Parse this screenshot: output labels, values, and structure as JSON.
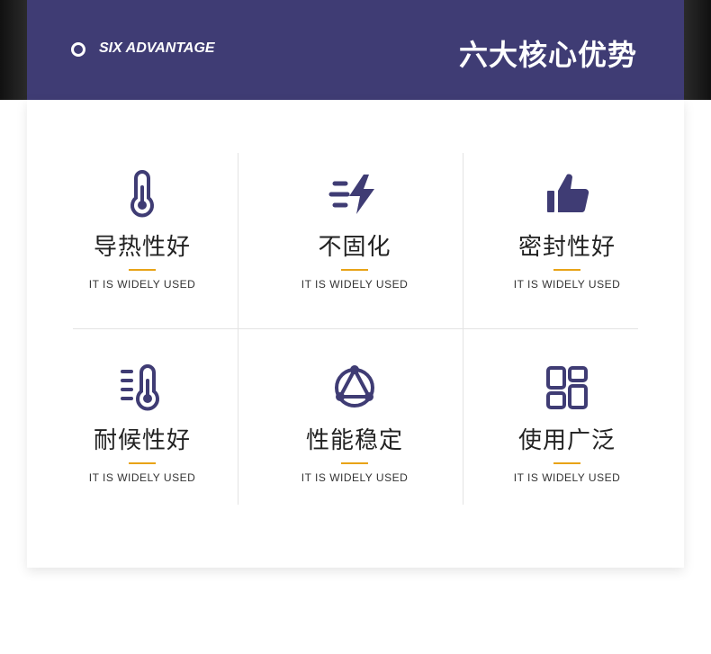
{
  "header": {
    "subtitle": "SIX ADVANTAGE",
    "title": "六大核心优势",
    "band_color": "#3f3c74",
    "accent_color": "#e8a317"
  },
  "advantages": [
    {
      "icon": "thermometer-icon",
      "label": "导热性好",
      "sub": "IT IS WIDELY USED"
    },
    {
      "icon": "lightning-speed-icon",
      "label": "不固化",
      "sub": "IT IS WIDELY USED"
    },
    {
      "icon": "thumbs-up-icon",
      "label": "密封性好",
      "sub": "IT IS WIDELY USED"
    },
    {
      "icon": "temperature-scale-icon",
      "label": "耐候性好",
      "sub": "IT IS WIDELY USED"
    },
    {
      "icon": "triangle-nodes-icon",
      "label": "性能稳定",
      "sub": "IT IS WIDELY USED"
    },
    {
      "icon": "dashboard-layout-icon",
      "label": "使用广泛",
      "sub": "IT IS WIDELY USED"
    }
  ]
}
